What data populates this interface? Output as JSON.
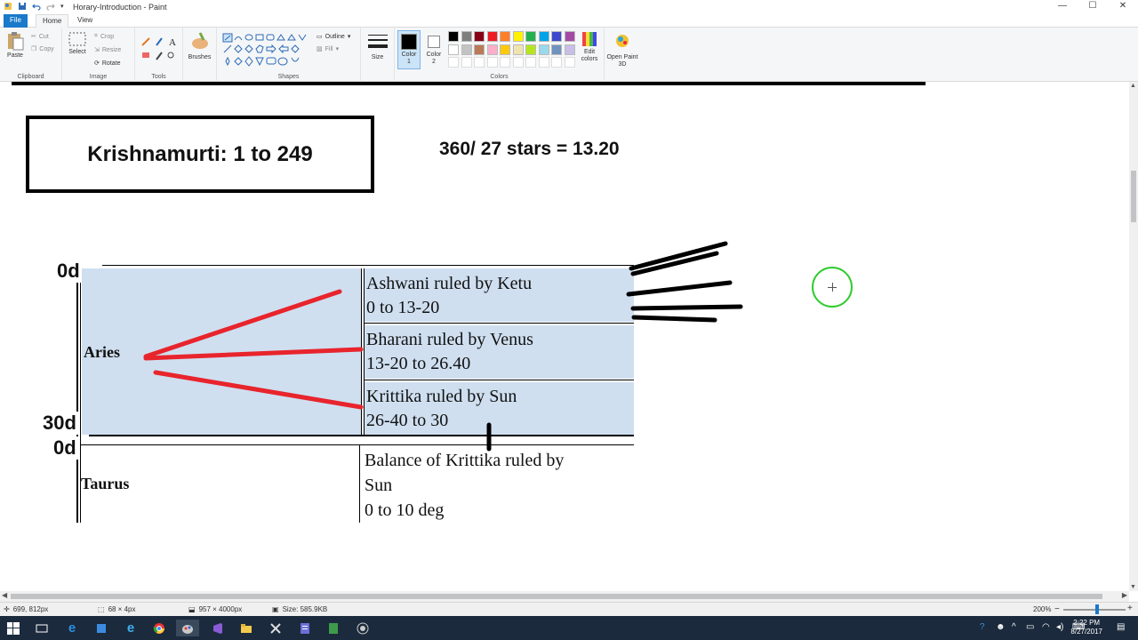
{
  "window": {
    "title": "Horary-Introduction - Paint",
    "minimize": "—",
    "maximize": "☐",
    "close": "✕"
  },
  "menu": {
    "file": "File",
    "home": "Home",
    "view": "View"
  },
  "ribbon": {
    "paste": "Paste",
    "cut": "Cut",
    "copy": "Copy",
    "clipboard": "Clipboard",
    "select": "Select",
    "crop": "Crop",
    "resize": "Resize",
    "rotate": "Rotate",
    "image": "Image",
    "tools": "Tools",
    "brushes": "Brushes",
    "outline": "Outline",
    "fill": "Fill",
    "shapes": "Shapes",
    "size": "Size",
    "color1": "Color 1",
    "color2": "Color 2",
    "edit_colors": "Edit colors",
    "colors": "Colors",
    "open_paint3d": "Open Paint 3D",
    "palette_row1": [
      "#000000",
      "#7f7f7f",
      "#880015",
      "#ed1c24",
      "#ff7f27",
      "#fff200",
      "#22b14c",
      "#00a2e8",
      "#3f48cc",
      "#a349a4"
    ],
    "palette_row2": [
      "#ffffff",
      "#c3c3c3",
      "#b97a57",
      "#ffaec9",
      "#ffc90e",
      "#efe4b0",
      "#b5e61d",
      "#99d9ea",
      "#7092be",
      "#c8bfe7"
    ],
    "color1_value": "#000000",
    "color2_value": "#ffffff"
  },
  "canvas": {
    "krishnamurti": "Krishnamurti: 1 to 249",
    "formula": "360/ 27 stars = 13.20",
    "deg_0_top": "0d",
    "deg_30": "30d",
    "deg_0_bottom": "0d",
    "aries": "Aries",
    "taurus": "Taurus",
    "ashwani_1": "Ashwani ruled by Ketu",
    "ashwani_2": "0 to 13-20",
    "bharani_1": "Bharani ruled by Venus",
    "bharani_2": "13-20 to 26.40",
    "krittika_1": "Krittika  ruled by Sun",
    "krittika_2": "26-40 to 30",
    "balance_1": "Balance of Krittika  ruled by",
    "balance_2": "Sun",
    "balance_3": "0 to 10 deg",
    "accent_red": "#e8242c",
    "cell_blue": "#cfdff0"
  },
  "status": {
    "position": "699, 812px",
    "selection": "68 × 4px",
    "canvas_size": "957 × 4000px",
    "file_size": "Size: 585.9KB",
    "zoom": "200%",
    "time": "2:22 PM",
    "date": "8/27/2017"
  }
}
